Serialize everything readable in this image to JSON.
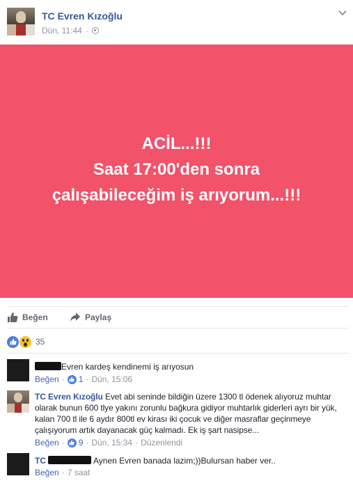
{
  "post": {
    "author": "TC Evren Kızoğlu",
    "timestamp": "Dün, 11:44",
    "privacy_icon": "globe-icon",
    "options_icon": "chevron-down-icon",
    "banner": {
      "background": "#f2526a",
      "lines": [
        "ACİL...!!!",
        "Saat 17:00'den sonra",
        "çalışabileceğim iş arıyorum...!!!"
      ]
    }
  },
  "actions": {
    "like_label": "Beğen",
    "share_label": "Paylaş"
  },
  "reactions": {
    "icons": [
      "like-icon",
      "wow-icon"
    ],
    "count": "35"
  },
  "comments": [
    {
      "name_redacted": true,
      "text": "Evren kardeş kendinemi iş arıyosun",
      "like_label": "Beğen",
      "likes": "1",
      "time": "Dün, 15:06"
    },
    {
      "name": "TC Evren Kızoğlu",
      "text": "Evet abi seninde bildiğin üzere 1300 tl ödenek alıyoruz muhtar olarak bunun 600 tlye yakını zorunlu bağkura gidiyor muhtarlık giderleri ayrı bir yük, kalan 700 tl ile 6 aydır 800tl ev kirası iki çocuk ve diğer masraflar geçinmeye çalışıyorum artık dayanacak güç kalmadı. Ek iş şart nasipse...",
      "like_label": "Beğen",
      "likes": "9",
      "time": "Dün, 15:34",
      "edited": "Düzenlendi"
    },
    {
      "name_prefix": "TC",
      "name_redacted": true,
      "text": "Aynen Evren banada lazim;))Bulursan haber ver..",
      "like_label": "Beğen",
      "time": "7 saat"
    }
  ]
}
